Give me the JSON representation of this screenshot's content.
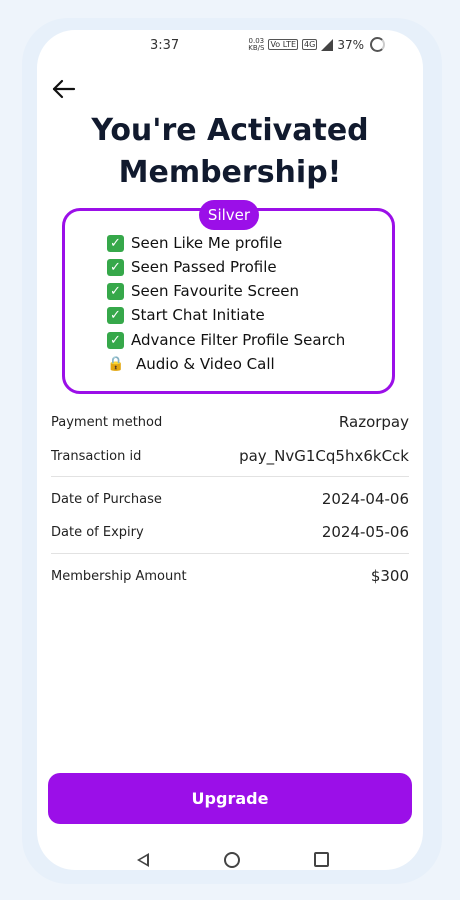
{
  "status_bar": {
    "time": "3:37",
    "net_speed_value": "0.03",
    "net_speed_unit": "KB/S",
    "volte_label": "Vo LTE",
    "network_label": "4G",
    "battery_percent": "37%"
  },
  "header": {
    "title_line1": "You're Activated",
    "title_line2": "Membership!"
  },
  "plan": {
    "name": "Silver",
    "features": [
      {
        "icon": "check-mark-icon",
        "label": "Seen Like Me profile"
      },
      {
        "icon": "check-mark-icon",
        "label": "Seen Passed Profile"
      },
      {
        "icon": "check-mark-icon",
        "label": "Seen Favourite Screen"
      },
      {
        "icon": "check-mark-icon",
        "label": "Start Chat Initiate"
      },
      {
        "icon": "check-mark-icon",
        "label": "Advance Filter Profile Search"
      },
      {
        "icon": "lock-icon",
        "label": "Audio & Video Call"
      }
    ]
  },
  "details": {
    "payment_method_label": "Payment method",
    "payment_method_value": "Razorpay",
    "transaction_id_label": "Transaction id",
    "transaction_id_value": "pay_NvG1Cq5hx6kCck",
    "purchase_date_label": "Date of Purchase",
    "purchase_date_value": "2024-04-06",
    "expiry_date_label": "Date of Expiry",
    "expiry_date_value": "2024-05-06",
    "amount_label": "Membership Amount",
    "amount_value": "$300"
  },
  "actions": {
    "upgrade_label": "Upgrade"
  },
  "colors": {
    "accent": "#9b0fe8",
    "title": "#111a2e",
    "check": "#36a84a"
  }
}
